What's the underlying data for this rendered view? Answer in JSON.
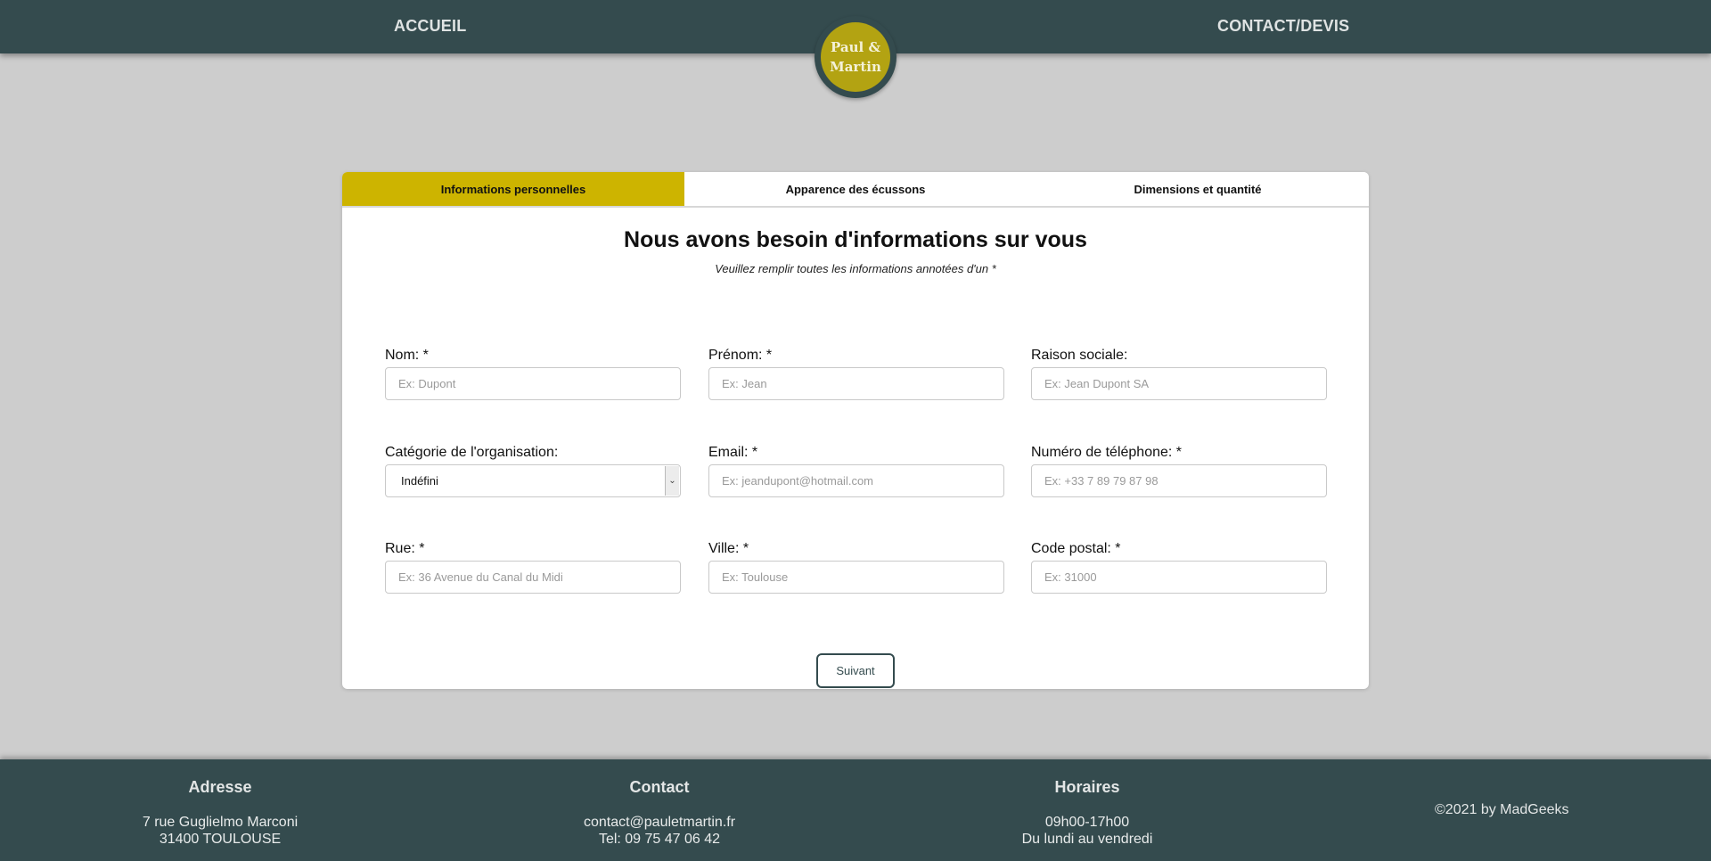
{
  "header": {
    "nav_left": "ACCUEIL",
    "nav_right": "CONTACT/DEVIS",
    "logo_line1": "Paul &",
    "logo_line2": "Martin"
  },
  "tabs": [
    {
      "label": "Informations personnelles",
      "active": true
    },
    {
      "label": "Apparence des écussons",
      "active": false
    },
    {
      "label": "Dimensions et quantité",
      "active": false
    }
  ],
  "form": {
    "title": "Nous avons besoin d'informations sur vous",
    "subtitle": "Veuillez remplir toutes les informations annotées d'un *",
    "fields": {
      "nom": {
        "label": "Nom: *",
        "placeholder": "Ex: Dupont"
      },
      "prenom": {
        "label": "Prénom: *",
        "placeholder": "Ex: Jean"
      },
      "raison": {
        "label": "Raison sociale:",
        "placeholder": "Ex: Jean Dupont SA"
      },
      "categorie": {
        "label": "Catégorie de l'organisation:",
        "value": "Indéfini"
      },
      "email": {
        "label": "Email: *",
        "placeholder": "Ex: jeandupont@hotmail.com"
      },
      "telephone": {
        "label": "Numéro de téléphone: *",
        "placeholder": "Ex: +33 7 89 79 87 98"
      },
      "rue": {
        "label": "Rue: *",
        "placeholder": "Ex: 36 Avenue du Canal du Midi"
      },
      "ville": {
        "label": "Ville: *",
        "placeholder": "Ex: Toulouse"
      },
      "codepostal": {
        "label": "Code postal: *",
        "placeholder": "Ex: 31000"
      }
    },
    "next_button": "Suivant"
  },
  "footer": {
    "address": {
      "title": "Adresse",
      "line1": "7 rue Guglielmo Marconi",
      "line2": "31400 TOULOUSE"
    },
    "contact": {
      "title": "Contact",
      "line1": "contact@pauletmartin.fr",
      "line2": "Tel: 09 75 47 06 42"
    },
    "hours": {
      "title": "Horaires",
      "line1": "09h00-17h00",
      "line2": "Du lundi au vendredi"
    },
    "copyright": "©2021 by MadGeeks"
  },
  "colors": {
    "header_bg": "#344b4e",
    "accent": "#cdb400",
    "page_bg": "#cdcdcd"
  }
}
